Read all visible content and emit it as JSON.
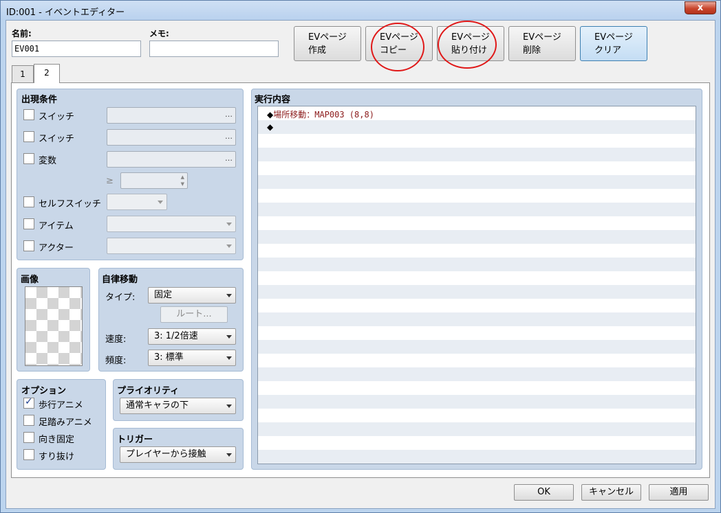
{
  "window": {
    "title": "ID:001 - イベントエディター",
    "close_label": "x"
  },
  "name_field": {
    "label": "名前:",
    "value": "EV001"
  },
  "memo_field": {
    "label": "メモ:",
    "value": ""
  },
  "toolbar": {
    "buttons": [
      {
        "line1": "EVページ",
        "line2": "作成"
      },
      {
        "line1": "EVページ",
        "line2": "コピー"
      },
      {
        "line1": "EVページ",
        "line2": "貼り付け"
      },
      {
        "line1": "EVページ",
        "line2": "削除"
      },
      {
        "line1": "EVページ",
        "line2": "クリア"
      }
    ]
  },
  "tabs": [
    "1",
    "2"
  ],
  "conditions": {
    "title": "出現条件",
    "switch1": "スイッチ",
    "switch2": "スイッチ",
    "variable": "変数",
    "ge_symbol": "≥",
    "self_switch": "セルフスイッチ",
    "item": "アイテム",
    "actor": "アクター",
    "dots": "…"
  },
  "image": {
    "title": "画像"
  },
  "autonomous": {
    "title": "自律移動",
    "type_label": "タイプ:",
    "type_value": "固定",
    "route_button": "ルート...",
    "speed_label": "速度:",
    "speed_value": "3: 1/2倍速",
    "freq_label": "頻度:",
    "freq_value": "3: 標準"
  },
  "options": {
    "title": "オプション",
    "items": [
      {
        "label": "歩行アニメ",
        "checked": true
      },
      {
        "label": "足踏みアニメ",
        "checked": false
      },
      {
        "label": "向き固定",
        "checked": false
      },
      {
        "label": "すり抜け",
        "checked": false
      }
    ]
  },
  "priority": {
    "title": "プライオリティ",
    "value": "通常キャラの下"
  },
  "trigger": {
    "title": "トリガー",
    "value": "プレイヤーから接触"
  },
  "contents": {
    "title": "実行内容",
    "commands": [
      {
        "bullet": "◆",
        "text": "場所移動：MAP003 (8,8)"
      },
      {
        "bullet": "◆",
        "text": ""
      }
    ]
  },
  "footer": {
    "ok": "OK",
    "cancel": "キャンセル",
    "apply": "適用"
  },
  "colors": {
    "annotation": "#e01818",
    "command_text": "#8b1a1a",
    "panel": "#c9d7e8"
  }
}
